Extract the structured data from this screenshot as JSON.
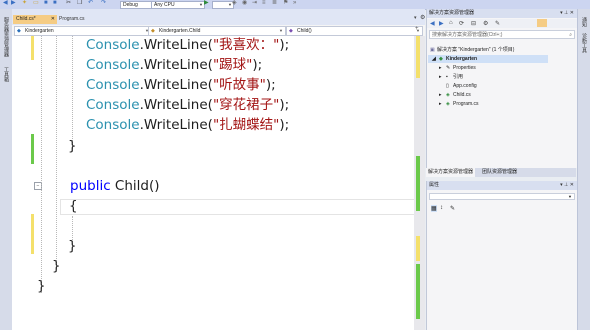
{
  "toolbar": {
    "debug_label": "Debug",
    "cpu_label": "Any CPU",
    "start_icon": "play-icon"
  },
  "left_strip": {
    "label_top": "服务器资源管理器",
    "label_bottom": "工具箱"
  },
  "tabs": [
    {
      "label": "Child.cs*",
      "active": true
    },
    {
      "label": "Program.cs",
      "active": false
    }
  ],
  "navbar": {
    "project": "Kindergarten",
    "class": "Kindergarten.Child",
    "member": "Child()"
  },
  "code_lines": [
    {
      "pre": "Console",
      "mid": ".WriteLine(",
      "str": "\"我喜欢：\"",
      "post": ");"
    },
    {
      "pre": "Console",
      "mid": ".WriteLine(",
      "str": "\"踢球\"",
      "post": ");"
    },
    {
      "pre": "Console",
      "mid": ".WriteLine(",
      "str": "\"听故事\"",
      "post": ");"
    },
    {
      "pre": "Console",
      "mid": ".WriteLine(",
      "str": "\"穿花裙子\"",
      "post": ");"
    },
    {
      "pre": "Console",
      "mid": ".WriteLine(",
      "str": "\"扎蝴蝶结\"",
      "post": ");"
    }
  ],
  "code_brace_1": "}",
  "code_public": "public",
  "code_ctor": " Child()",
  "code_brace_open": "{",
  "code_brace_2": "}",
  "code_brace_3": "}",
  "code_brace_4": "}",
  "solution_explorer": {
    "title": "解决方案资源管理器",
    "search_placeholder": "搜索解决方案资源管理器(Ctrl+;)",
    "solution": "解决方案 \"Kindergarten\" (1 个项目)",
    "project": "Kindergarten",
    "items": [
      "Properties",
      "引用",
      "App.config",
      "Child.cs",
      "Program.cs"
    ]
  },
  "bottom_tabs": {
    "se_tab": "解决方案资源管理器",
    "team_tab": "团队资源管理器"
  },
  "properties": {
    "title": "属性"
  },
  "right_strip": {
    "label_top": "通知",
    "label_bottom": "诊断工具"
  },
  "colors": {
    "accent_tab": "#f5cc84",
    "change_bar": "#6bc94a",
    "string": "#a31515",
    "type": "#2b91af",
    "keyword": "#0000ff"
  }
}
